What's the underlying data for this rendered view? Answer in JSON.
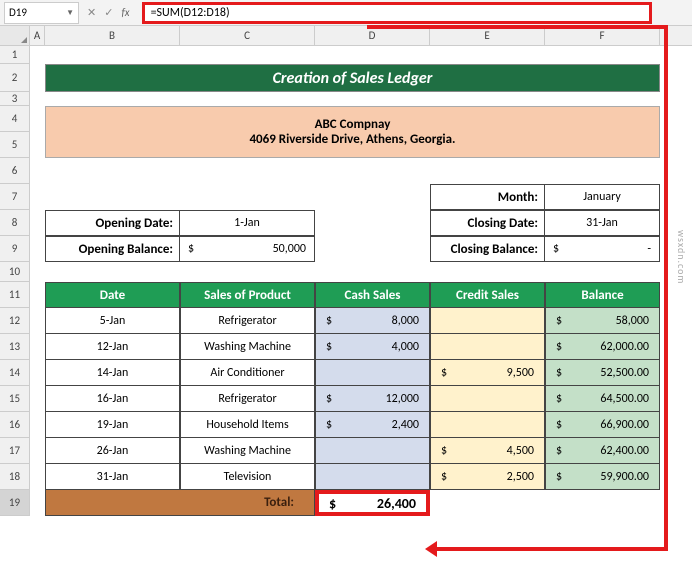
{
  "namebox": "D19",
  "formula": "=SUM(D12:D18)",
  "cols": [
    "A",
    "B",
    "C",
    "D",
    "E",
    "F"
  ],
  "rows": [
    "1",
    "2",
    "3",
    "4",
    "5",
    "6",
    "7",
    "8",
    "9",
    "10",
    "11",
    "12",
    "13",
    "14",
    "15",
    "16",
    "17",
    "18",
    "19"
  ],
  "title": "Creation of Sales Ledger",
  "company": {
    "name": "ABC Compnay",
    "addr": "4069 Riverside Drive, Athens, Georgia."
  },
  "info_left": [
    {
      "label": "Opening Date:",
      "value": "1-Jan"
    },
    {
      "label": "Opening Balance:",
      "dollar": "$",
      "value": "50,000"
    }
  ],
  "info_right": [
    {
      "label": "Month:",
      "value": "January"
    },
    {
      "label": "Closing Date:",
      "value": "31-Jan"
    },
    {
      "label": "Closing Balance:",
      "dollar": "$",
      "value": "-"
    }
  ],
  "headers": [
    "Date",
    "Sales of Product",
    "Cash Sales",
    "Credit Sales",
    "Balance"
  ],
  "chart_data": {
    "type": "table",
    "columns": [
      "Date",
      "Sales of Product",
      "Cash Sales",
      "Credit Sales",
      "Balance"
    ],
    "rows": [
      {
        "date": "5-Jan",
        "product": "Refrigerator",
        "cash": "8,000",
        "credit": "",
        "balance": "58,000"
      },
      {
        "date": "12-Jan",
        "product": "Washing Machine",
        "cash": "4,000",
        "credit": "",
        "balance": "62,000.00"
      },
      {
        "date": "14-Jan",
        "product": "Air Conditioner",
        "cash": "",
        "credit": "9,500",
        "balance": "52,500.00"
      },
      {
        "date": "16-Jan",
        "product": "Refrigerator",
        "cash": "12,000",
        "credit": "",
        "balance": "64,500.00"
      },
      {
        "date": "19-Jan",
        "product": "Household Items",
        "cash": "2,400",
        "credit": "",
        "balance": "66,900.00"
      },
      {
        "date": "26-Jan",
        "product": "Washing Machine",
        "cash": "",
        "credit": "4,500",
        "balance": "62,400.00"
      },
      {
        "date": "31-Jan",
        "product": "Television",
        "cash": "",
        "credit": "2,500",
        "balance": "59,900.00"
      }
    ],
    "total": {
      "label": "Total:",
      "cash": "26,400"
    }
  },
  "watermark": "wsxdn.com"
}
